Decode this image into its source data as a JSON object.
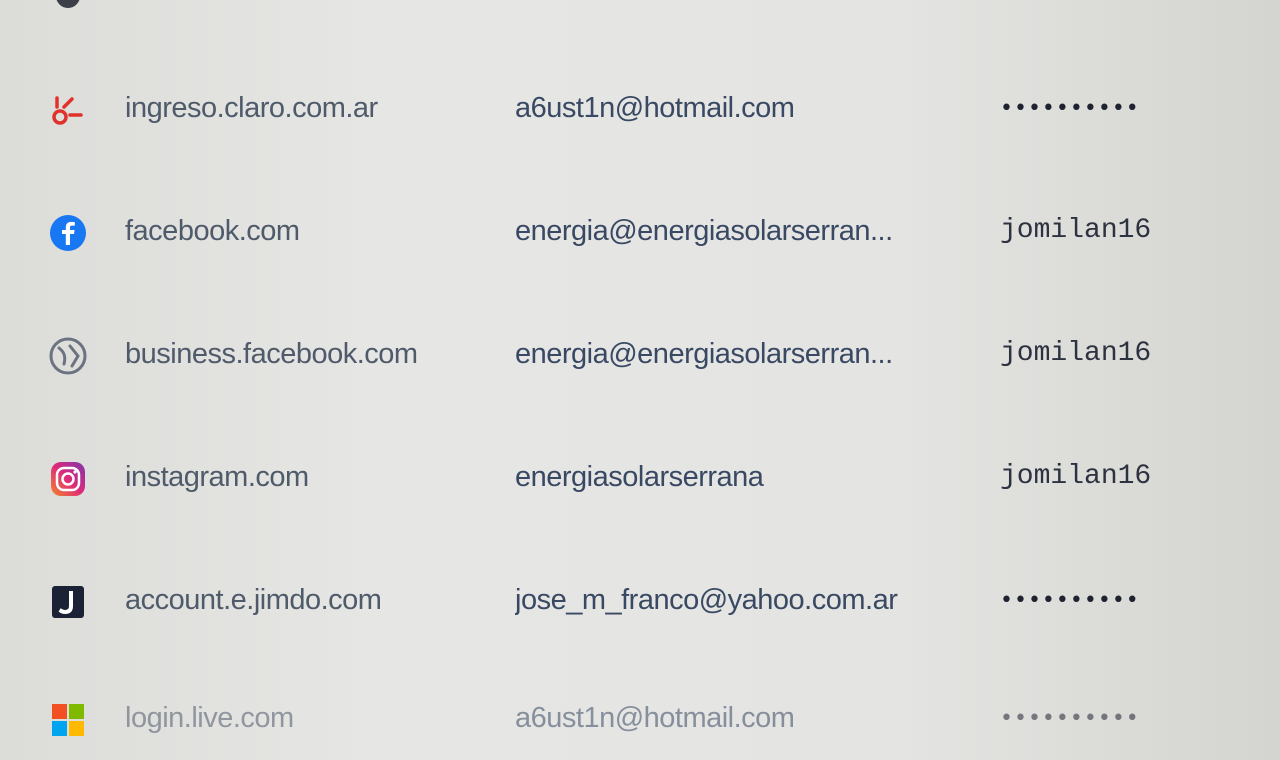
{
  "passwords": [
    {
      "site": "ingreso.claro.com.ar",
      "username": "a6ust1n@hotmail.com",
      "password": "••••••••••",
      "password_masked": true,
      "icon": "claro-icon"
    },
    {
      "site": "facebook.com",
      "username": "energia@energiasolarserran...",
      "password": "jomilan16",
      "password_masked": false,
      "icon": "facebook-icon"
    },
    {
      "site": "business.facebook.com",
      "username": "energia@energiasolarserran...",
      "password": "jomilan16",
      "password_masked": false,
      "icon": "globe-icon"
    },
    {
      "site": "instagram.com",
      "username": "energiasolarserrana",
      "password": "jomilan16",
      "password_masked": false,
      "icon": "instagram-icon"
    },
    {
      "site": "account.e.jimdo.com",
      "username": "jose_m_franco@yahoo.com.ar",
      "password": "••••••••••",
      "password_masked": true,
      "icon": "jimdo-icon"
    },
    {
      "site": "login.live.com",
      "username": "a6ust1n@hotmail.com",
      "password": "••••••••••",
      "password_masked": true,
      "icon": "microsoft-icon"
    }
  ],
  "colors": {
    "site_text": "#4f5a6a",
    "user_text": "#3a4963",
    "facebook": "#1877f2",
    "claro": "#e0322b",
    "jimdo": "#1c2236"
  }
}
